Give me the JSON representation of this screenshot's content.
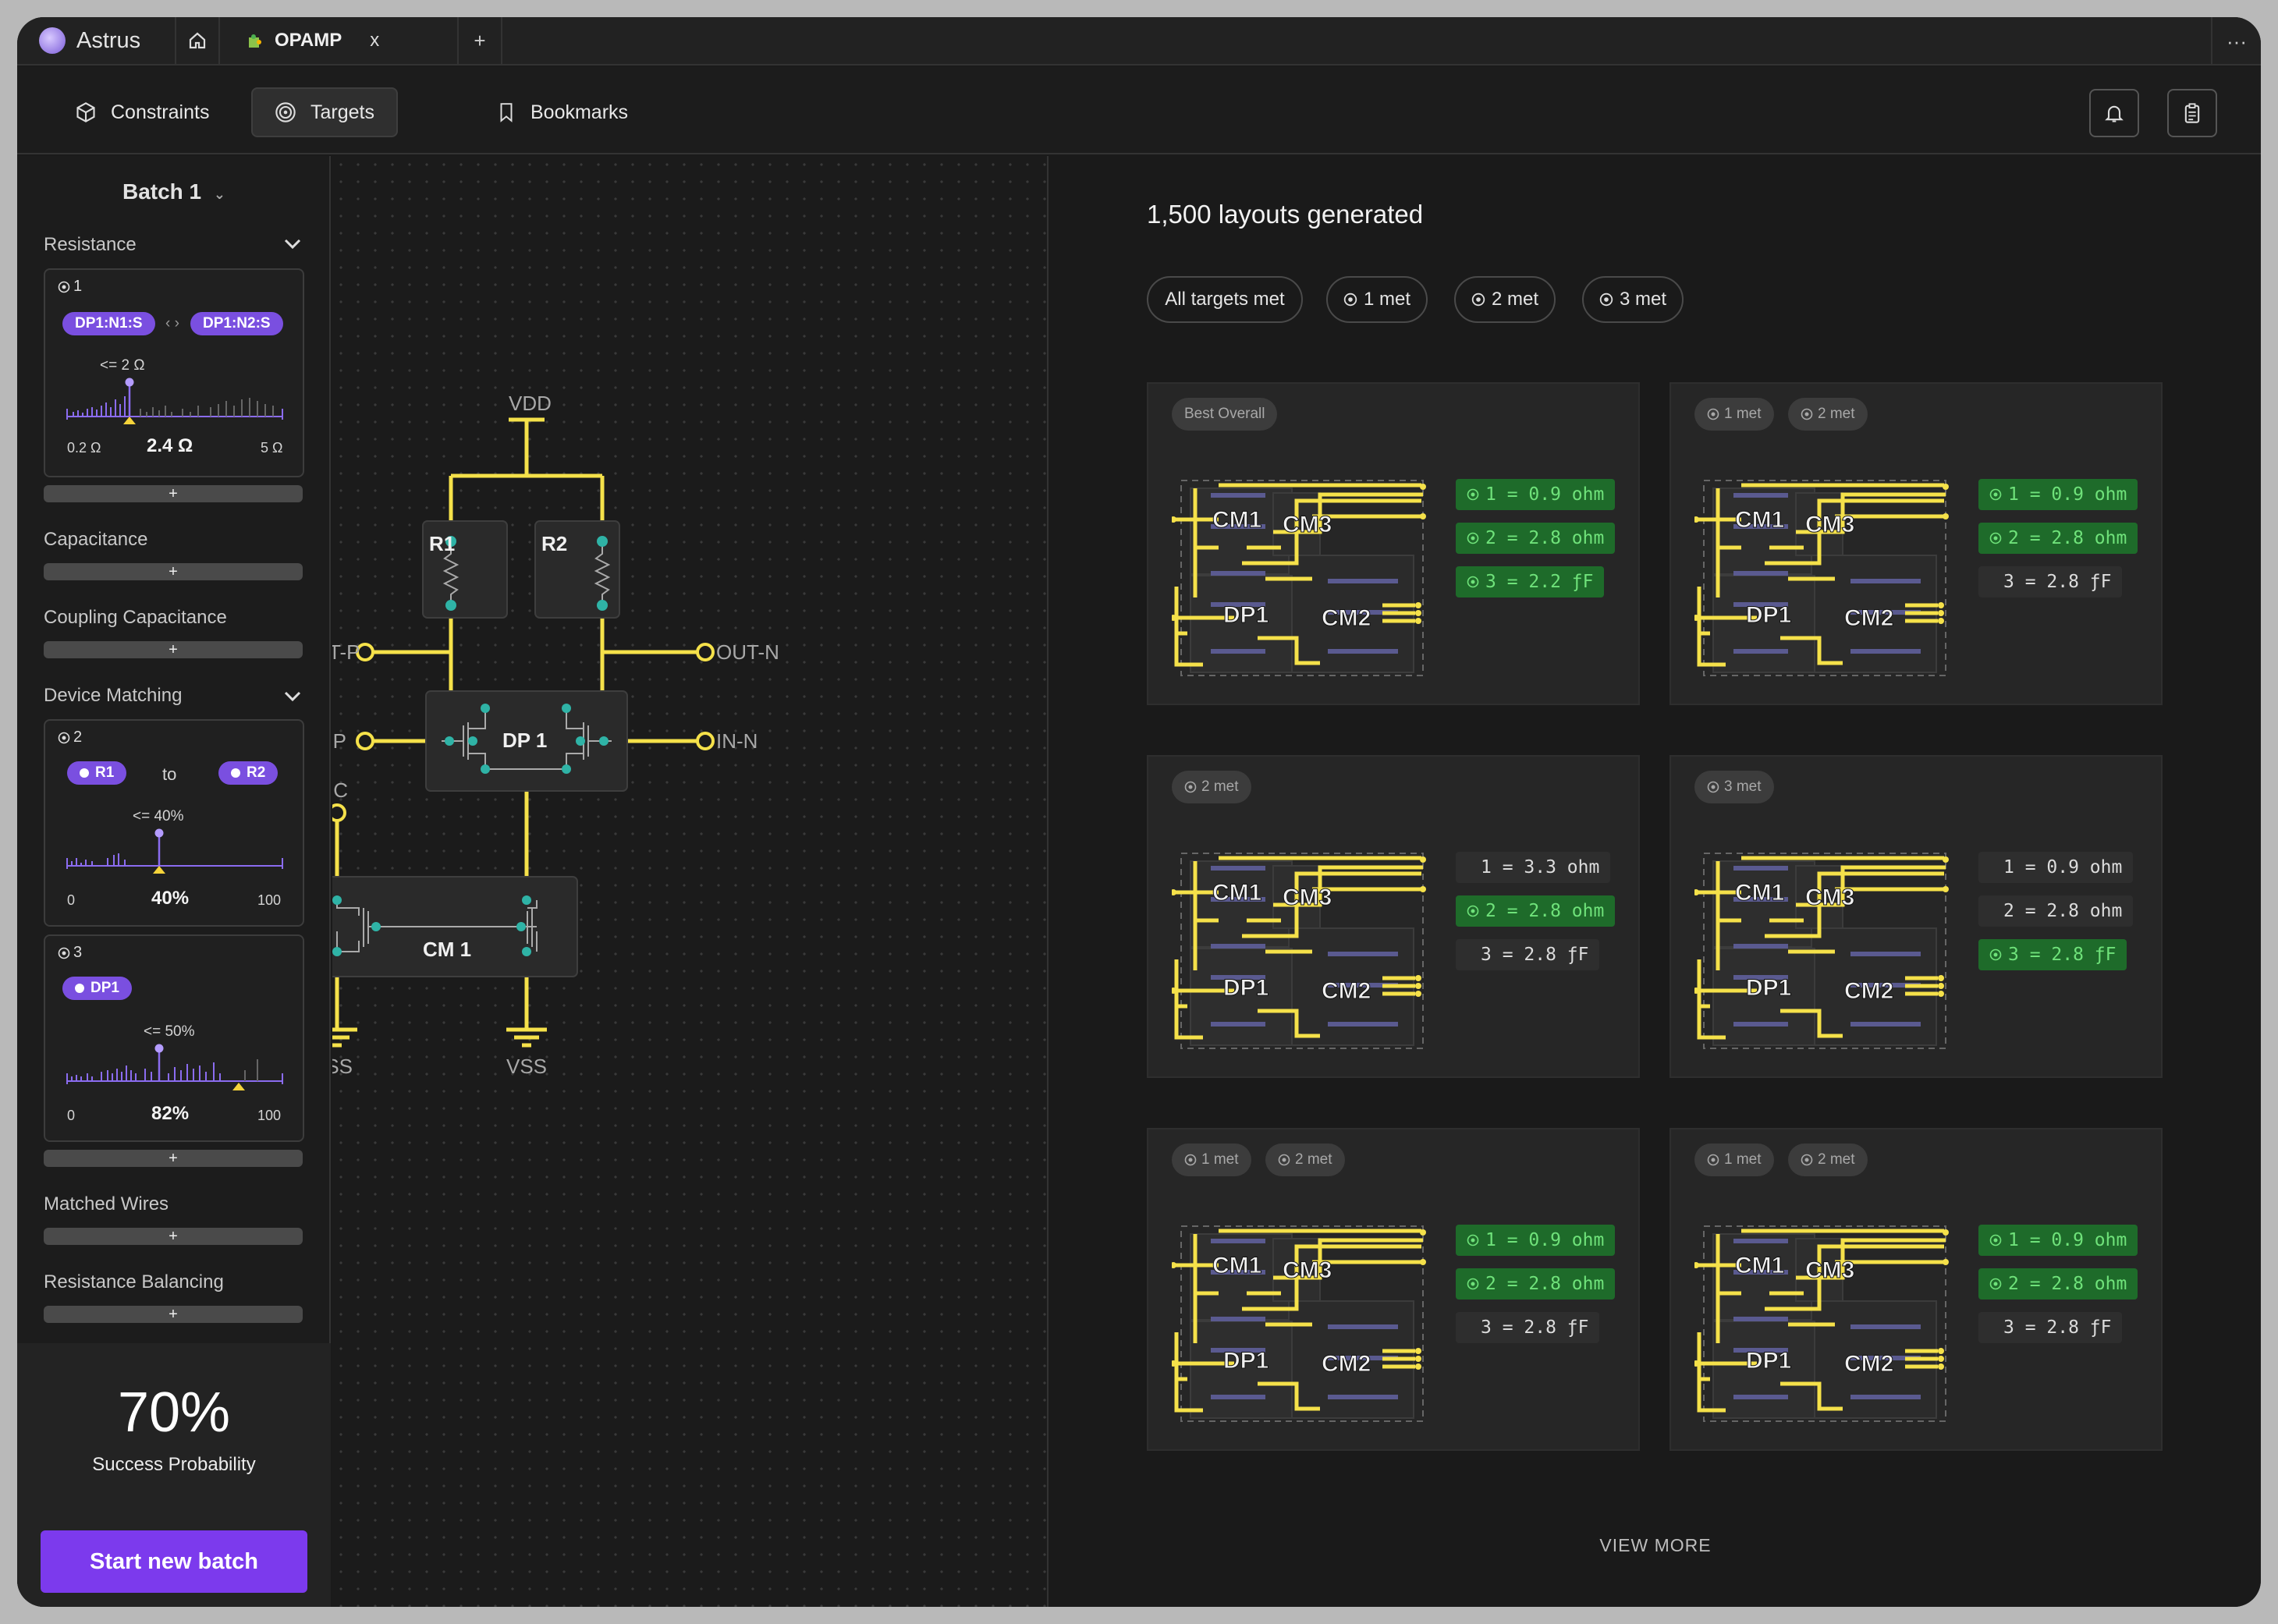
{
  "app": {
    "brand": "Astrus",
    "tab_label": "OPAMP",
    "tab_close": "x",
    "new_tab": "+",
    "more": "···"
  },
  "nav": {
    "tabs": [
      {
        "label": "Constraints",
        "icon": "cube-icon"
      },
      {
        "label": "Targets",
        "icon": "target-icon",
        "active": true
      },
      {
        "label": "Bookmarks",
        "icon": "bookmark-icon"
      }
    ],
    "right_icons": [
      "bell-icon",
      "clipboard-icon"
    ]
  },
  "sidebar": {
    "batch": "Batch 1",
    "sections": {
      "resistance": "Resistance",
      "capacitance": "Capacitance",
      "coupling": "Coupling Capacitance",
      "matching": "Device Matching",
      "matched_wires": "Matched Wires",
      "balancing": "Resistance Balancing"
    },
    "plus": "+",
    "card1": {
      "tag": "1",
      "from": "DP1:N1:S",
      "to": "DP1:N2:S",
      "limit": "<= 2 Ω",
      "min": "0.2 Ω",
      "value": "2.4 Ω",
      "max": "5 Ω"
    },
    "card2": {
      "tag": "2",
      "from": "R1",
      "to_word": "to",
      "to": "R2",
      "limit": "<= 40%",
      "min": "0",
      "value": "40%",
      "max": "100"
    },
    "card3": {
      "tag": "3",
      "device": "DP1",
      "limit": "<= 50%",
      "min": "0",
      "value": "82%",
      "max": "100"
    },
    "success_pct": "70%",
    "success_label": "Success Probability",
    "start_button": "Start new batch"
  },
  "schematic": {
    "vdd": "VDD",
    "r1": "R1",
    "r2": "R2",
    "out_p": "OUT-P",
    "out_n": "OUT-N",
    "in_p": "IN-P",
    "in_n": "IN-N",
    "dp1": "DP 1",
    "ic": "IC",
    "cm1": "CM 1",
    "vss1": "VSS",
    "vss2": "VSS"
  },
  "results": {
    "title": "1,500 layouts generated",
    "filters": [
      "All targets met",
      "1 met",
      "2 met",
      "3 met"
    ],
    "layout_labels": {
      "cm1": "CM1",
      "cm3": "CM3",
      "dp1": "DP1",
      "cm2": "CM2"
    },
    "cards": [
      {
        "pills": [
          "Best Overall"
        ],
        "metrics": [
          {
            "text": "1 = 0.9 ohm",
            "ok": true
          },
          {
            "text": "2 = 2.8 ohm",
            "ok": true
          },
          {
            "text": "3 = 2.2 ƒF",
            "ok": true
          }
        ]
      },
      {
        "pills": [
          "1 met",
          "2 met"
        ],
        "metrics": [
          {
            "text": "1 = 0.9 ohm",
            "ok": true
          },
          {
            "text": "2 = 2.8 ohm",
            "ok": true
          },
          {
            "text": "3 = 2.8 ƒF",
            "ok": false
          }
        ]
      },
      {
        "pills": [
          "2 met"
        ],
        "metrics": [
          {
            "text": "1 = 3.3 ohm",
            "ok": false
          },
          {
            "text": "2 = 2.8 ohm",
            "ok": true
          },
          {
            "text": "3 = 2.8 ƒF",
            "ok": false
          }
        ]
      },
      {
        "pills": [
          "3 met"
        ],
        "metrics": [
          {
            "text": "1 = 0.9 ohm",
            "ok": false
          },
          {
            "text": "2 = 2.8 ohm",
            "ok": false
          },
          {
            "text": "3 = 2.8 ƒF",
            "ok": true
          }
        ]
      },
      {
        "pills": [
          "1 met",
          "2 met"
        ],
        "metrics": [
          {
            "text": "1 = 0.9 ohm",
            "ok": true
          },
          {
            "text": "2 = 2.8 ohm",
            "ok": true
          },
          {
            "text": "3 = 2.8 ƒF",
            "ok": false
          }
        ]
      },
      {
        "pills": [
          "1 met",
          "2 met"
        ],
        "metrics": [
          {
            "text": "1 = 0.9 ohm",
            "ok": true
          },
          {
            "text": "2 = 2.8 ohm",
            "ok": true
          },
          {
            "text": "3 = 2.8 ƒF",
            "ok": false
          }
        ]
      }
    ],
    "view_more": "VIEW MORE"
  },
  "colors": {
    "accent": "#7c3aed",
    "wire": "#f5e14a",
    "node": "#2fb3a6",
    "ok_bg": "#1e6b2a",
    "ok_text": "#6fe27a"
  }
}
